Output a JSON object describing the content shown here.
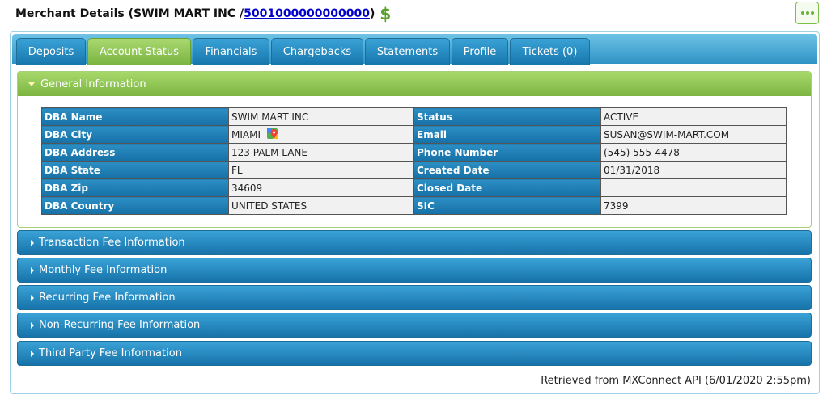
{
  "header": {
    "title_prefix": "Merchant Details (SWIM MART INC / ",
    "merchant_id": "5001000000000000",
    "title_suffix": ")",
    "dollar_symbol": "$"
  },
  "tabs": [
    {
      "label": "Deposits"
    },
    {
      "label": "Account Status"
    },
    {
      "label": "Financials"
    },
    {
      "label": "Chargebacks"
    },
    {
      "label": "Statements"
    },
    {
      "label": "Profile"
    },
    {
      "label": "Tickets (0)"
    }
  ],
  "active_tab": "Account Status",
  "general": {
    "title": "General Information",
    "rows": [
      {
        "label1": "DBA Name",
        "value1": "SWIM MART INC",
        "label2": "Status",
        "value2": "ACTIVE"
      },
      {
        "label1": "DBA City",
        "value1": "MIAMI",
        "label2": "Email",
        "value2": "SUSAN@SWIM-MART.COM"
      },
      {
        "label1": "DBA Address",
        "value1": "123 PALM LANE",
        "label2": "Phone Number",
        "value2": "(545) 555-4478"
      },
      {
        "label1": "DBA State",
        "value1": "FL",
        "label2": "Created Date",
        "value2": "01/31/2018"
      },
      {
        "label1": "DBA Zip",
        "value1": "34609",
        "label2": "Closed Date",
        "value2": ""
      },
      {
        "label1": "DBA Country",
        "value1": "UNITED STATES",
        "label2": "SIC",
        "value2": "7399"
      }
    ]
  },
  "sections": [
    {
      "title": "Transaction Fee Information"
    },
    {
      "title": "Monthly Fee Information"
    },
    {
      "title": "Recurring Fee Information"
    },
    {
      "title": "Non-Recurring Fee Information"
    },
    {
      "title": "Third Party Fee Information"
    }
  ],
  "footer": {
    "text": "Retrieved from MXConnect API (6/01/2020 2:55pm)"
  },
  "colors": {
    "accent_green": "#7ab541",
    "accent_blue": "#1a7ab0",
    "link": "#0000cc"
  },
  "icons": [
    "dollar-icon",
    "more-menu-icon",
    "caret-down-icon",
    "caret-right-icon",
    "map-pin-icon"
  ]
}
